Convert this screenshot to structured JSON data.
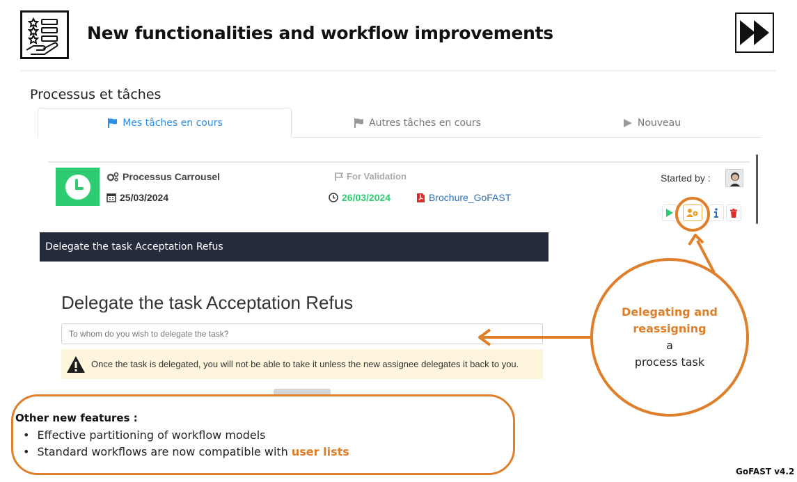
{
  "slide": {
    "title": "New functionalities and workflow improvements",
    "logo_icon": "checklist-hand-icon",
    "nav_icon": "fast-forward-icon",
    "version": "GoFAST v4.2"
  },
  "app": {
    "section_title": "Processus et tâches",
    "tabs": [
      {
        "label": "Mes tâches en cours",
        "icon": "flag-icon",
        "active": true
      },
      {
        "label": "Autres tâches en cours",
        "icon": "flag-icon",
        "active": false
      },
      {
        "label": "Nouveau",
        "icon": "play-icon",
        "active": false
      }
    ],
    "task": {
      "process_name": "Processus Carrousel",
      "start_date": "25/03/2024",
      "status": "For Validation",
      "due_date": "26/03/2024",
      "document": "Brochure_GoFAST",
      "started_by_label": "Started by :"
    },
    "dialog": {
      "bar_title": "Delegate the task Acceptation Refus",
      "heading": "Delegate the task Acceptation Refus",
      "input_placeholder": "To whom do you wish to delegate the task?",
      "warning": "Once the task is delegated, you will not be able to take it unless the new assignee delegates it back to you."
    }
  },
  "callout": {
    "highlight": "Delegating and reassigning",
    "line_a": "a",
    "line_b": "process task"
  },
  "features": {
    "title": "Other new features :",
    "item1": "Effective partitioning of workflow models",
    "item2_prefix": "Standard workflows are now compatible with",
    "item2_highlight": "user lists"
  },
  "colors": {
    "accent": "#e07f2a",
    "tab_active": "#2d8ee6",
    "success": "#2ecc71",
    "dark_bar": "#252b3b",
    "warning_bg": "#fdf6dd"
  }
}
